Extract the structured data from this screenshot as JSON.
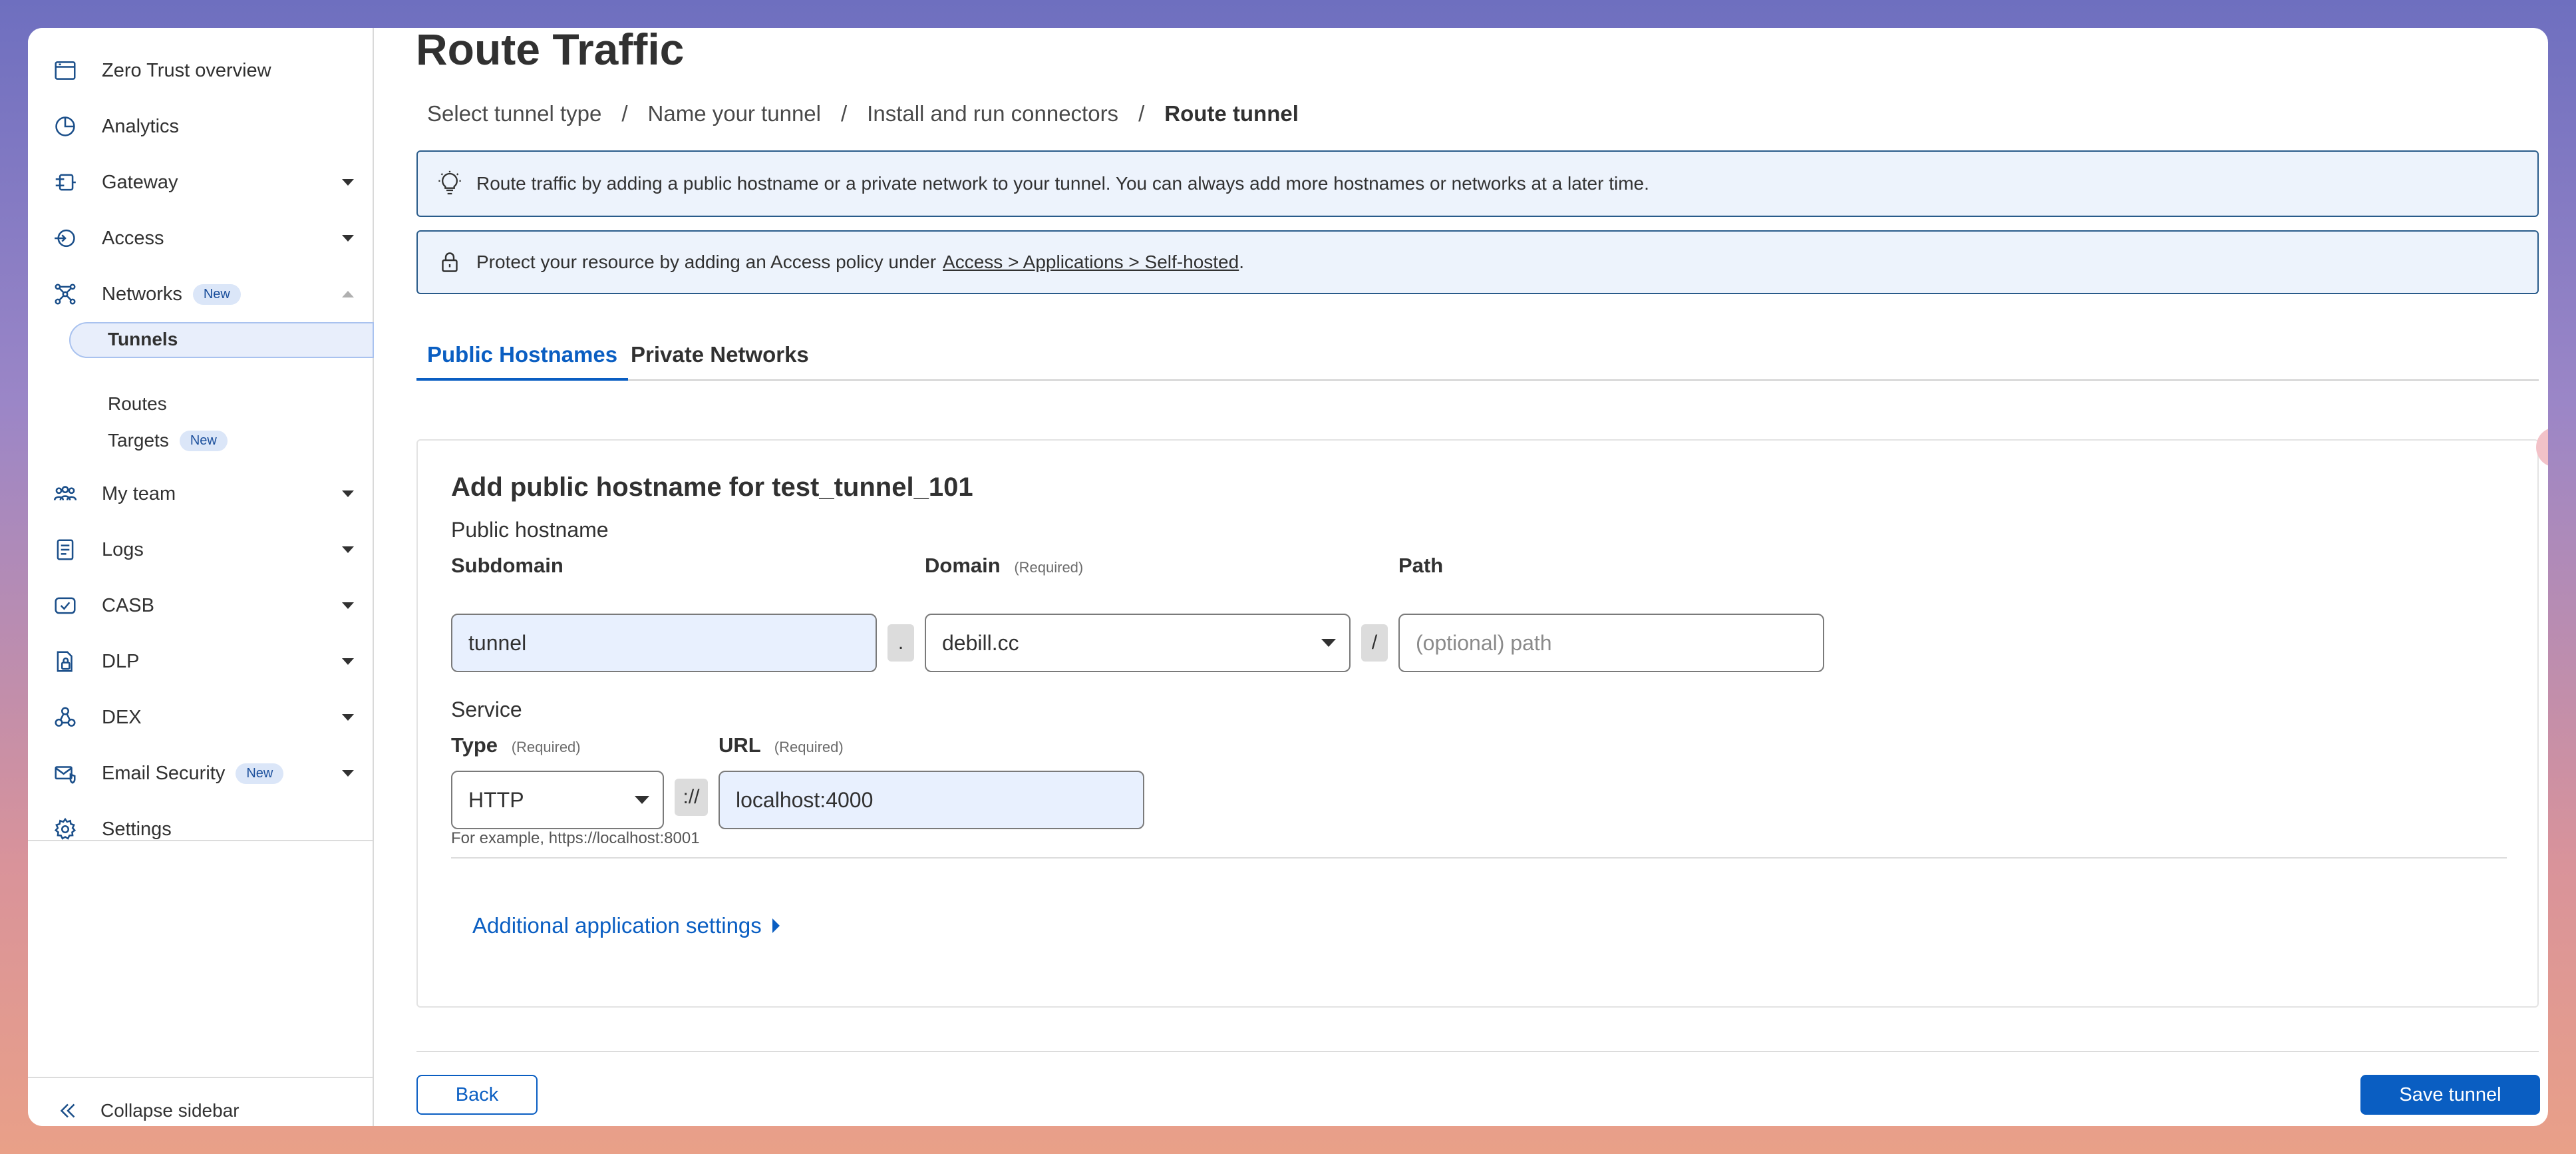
{
  "sidebar": {
    "items": [
      {
        "label": "Zero Trust overview",
        "icon": "overview-icon"
      },
      {
        "label": "Analytics",
        "icon": "analytics-icon"
      },
      {
        "label": "Gateway",
        "icon": "gateway-icon"
      },
      {
        "label": "Access",
        "icon": "access-icon"
      },
      {
        "label": "Networks",
        "icon": "networks-icon",
        "badge": "New"
      },
      {
        "label": "My team",
        "icon": "team-icon"
      },
      {
        "label": "Logs",
        "icon": "logs-icon"
      },
      {
        "label": "CASB",
        "icon": "casb-icon"
      },
      {
        "label": "DLP",
        "icon": "dlp-icon"
      },
      {
        "label": "DEX",
        "icon": "dex-icon"
      },
      {
        "label": "Email Security",
        "icon": "email-security-icon",
        "badge": "New"
      },
      {
        "label": "Settings",
        "icon": "settings-icon"
      }
    ],
    "sub_items": [
      {
        "label": "Tunnels"
      },
      {
        "label": "Routes"
      },
      {
        "label": "Targets",
        "badge": "New"
      }
    ],
    "collapse_label": "Collapse sidebar"
  },
  "page": {
    "title": "Route Traffic",
    "breadcrumbs": [
      "Select tunnel type",
      "Name your tunnel",
      "Install and run connectors",
      "Route tunnel"
    ],
    "breadcrumb_sep": "/",
    "info_banner": "Route traffic by adding a public hostname or a private network to your tunnel. You can always add more hostnames or networks at a later time.",
    "policy_banner": {
      "text": "Protect your resource by adding an Access policy under",
      "link": "Access > Applications > Self-hosted",
      "suffix": "."
    },
    "tabs": [
      "Public Hostnames",
      "Private Networks"
    ]
  },
  "form": {
    "title": "Add public hostname for test_tunnel_101",
    "hostname_group": "Public hostname",
    "subdomain_label": "Subdomain",
    "subdomain_value": "tunnel",
    "dot_sep": ".",
    "domain_label": "Domain",
    "domain_required": "(Required)",
    "domain_value": "debill.cc",
    "slash_sep": "/",
    "path_label": "Path",
    "path_placeholder": "(optional) path",
    "service_group": "Service",
    "type_label": "Type",
    "type_required": "(Required)",
    "type_value": "HTTP",
    "scheme_sep": "://",
    "url_label": "URL",
    "url_required": "(Required)",
    "url_value": "localhost:4000",
    "url_help": "For example, https://localhost:8001",
    "additional_settings": "Additional application settings"
  },
  "footer": {
    "back_label": "Back",
    "save_label": "Save tunnel"
  },
  "colors": {
    "accent": "#0a5ec2",
    "banner_bg": "#edf3fc",
    "input_filled_bg": "#e8f0fe"
  }
}
